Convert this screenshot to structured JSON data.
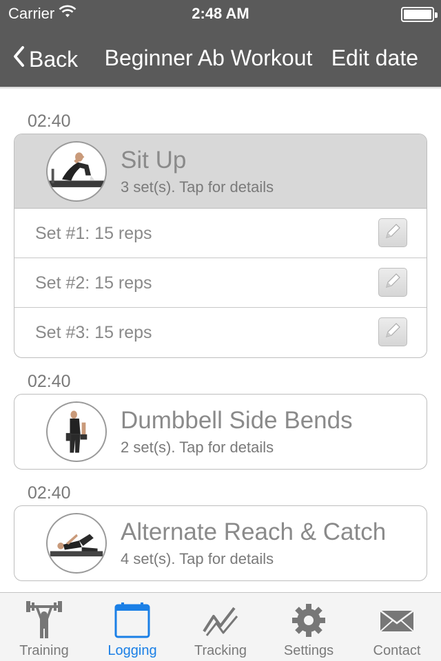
{
  "status": {
    "carrier": "Carrier",
    "time": "2:48 AM"
  },
  "nav": {
    "back_label": "Back",
    "title": "Beginner Ab Workout",
    "edit_label": "Edit date"
  },
  "entries": [
    {
      "time": "02:40",
      "name": "Sit Up",
      "subtitle": "3 set(s). Tap for details",
      "expanded": true,
      "sets": [
        "Set #1: 15 reps",
        "Set #2: 15 reps",
        "Set #3: 15 reps"
      ]
    },
    {
      "time": "02:40",
      "name": "Dumbbell Side Bends",
      "subtitle": "2 set(s). Tap for details",
      "expanded": false
    },
    {
      "time": "02:40",
      "name": "Alternate Reach & Catch",
      "subtitle": "4 set(s). Tap for details",
      "expanded": false
    }
  ],
  "tabs": [
    {
      "label": "Training",
      "icon": "weightlifter-icon",
      "active": false
    },
    {
      "label": "Logging",
      "icon": "calendar-icon",
      "active": true
    },
    {
      "label": "Tracking",
      "icon": "chart-line-icon",
      "active": false
    },
    {
      "label": "Settings",
      "icon": "gear-icon",
      "active": false
    },
    {
      "label": "Contact",
      "icon": "envelope-icon",
      "active": false
    }
  ],
  "colors": {
    "header": "#5a5a5a",
    "accent": "#1a7fe6",
    "expanded_bg": "#d8d8d8"
  }
}
